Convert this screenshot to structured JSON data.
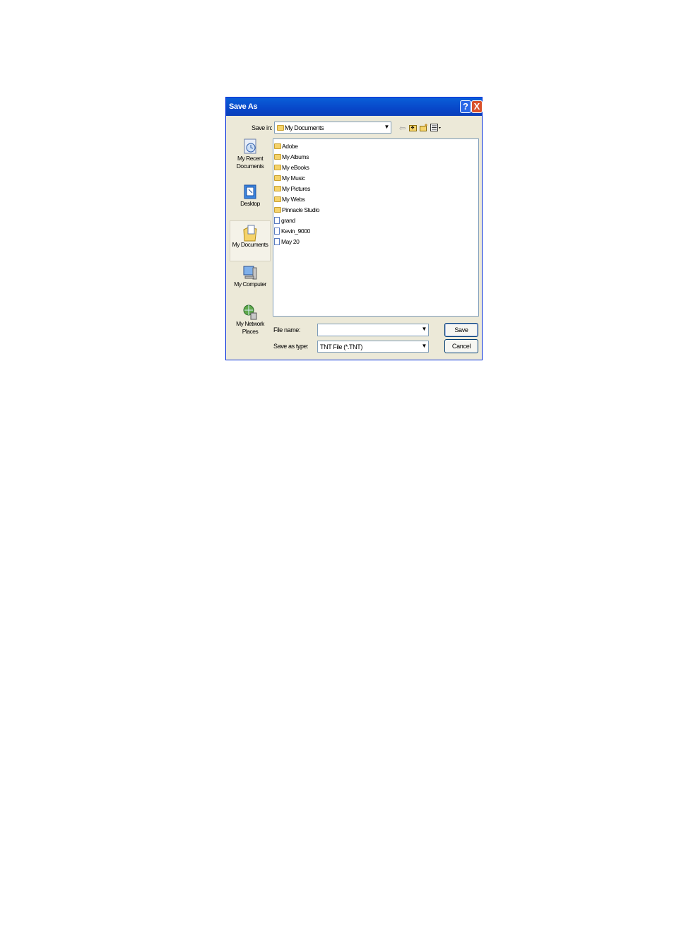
{
  "window": {
    "title": "Save As",
    "help_label": "?",
    "close_label": "X"
  },
  "toolbar": {
    "save_in_label": "Save in:",
    "save_in_value": "My Documents",
    "back_icon": "back-arrow-icon",
    "up_icon": "up-folder-icon",
    "new_folder_icon": "new-folder-icon",
    "views_icon": "views-menu-icon"
  },
  "places": [
    {
      "label": "My Recent Documents",
      "icon": "recent-documents-icon"
    },
    {
      "label": "Desktop",
      "icon": "desktop-icon"
    },
    {
      "label": "My Documents",
      "icon": "my-documents-icon",
      "selected": true
    },
    {
      "label": "My Computer",
      "icon": "my-computer-icon"
    },
    {
      "label": "My Network Places",
      "icon": "network-places-icon"
    }
  ],
  "files": [
    {
      "name": "Adobe",
      "type": "folder"
    },
    {
      "name": "My Albums",
      "type": "folder"
    },
    {
      "name": "My eBooks",
      "type": "folder"
    },
    {
      "name": "My Music",
      "type": "folder"
    },
    {
      "name": "My Pictures",
      "type": "folder"
    },
    {
      "name": "My Webs",
      "type": "folder"
    },
    {
      "name": "Pinnacle Studio",
      "type": "folder"
    },
    {
      "name": "grand",
      "type": "file"
    },
    {
      "name": "Kevin_9000",
      "type": "file"
    },
    {
      "name": "May 20",
      "type": "file"
    }
  ],
  "form": {
    "file_name_label": "File name:",
    "file_name_value": "",
    "save_as_type_label": "Save as type:",
    "save_as_type_value": "TNT File (*.TNT)"
  },
  "buttons": {
    "save": "Save",
    "cancel": "Cancel"
  }
}
